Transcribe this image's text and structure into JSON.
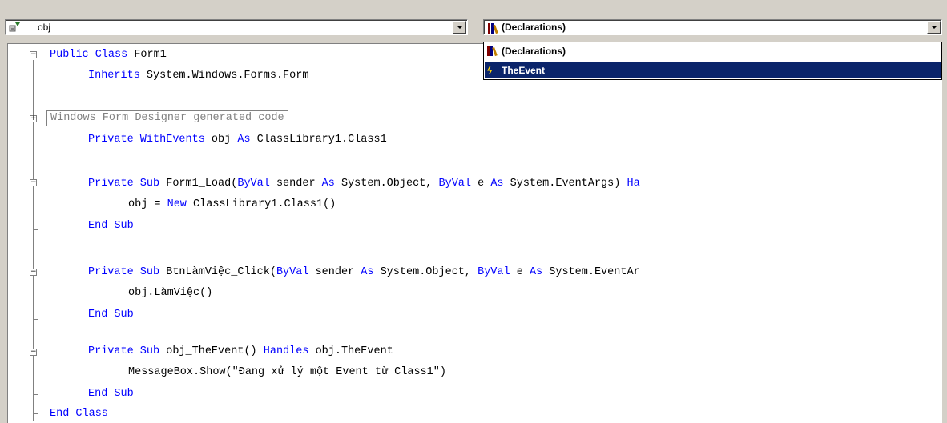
{
  "object_combo": {
    "value": "obj",
    "icon": "object-icon"
  },
  "member_combo": {
    "value": "(Declarations)",
    "icon": "declarations-icon"
  },
  "member_dropdown": {
    "items": [
      {
        "label": "(Declarations)",
        "icon": "declarations-icon",
        "selected": false
      },
      {
        "label": "TheEvent",
        "icon": "event-icon",
        "selected": true
      }
    ]
  },
  "code": {
    "lines": [
      [
        "Public Class",
        " Form1"
      ],
      [
        "Inherits",
        " System.Windows.Forms.Form"
      ],
      [
        "Windows Form Designer generated code"
      ],
      [
        "Private WithEvents",
        " obj ",
        "As",
        " ClassLibrary1.Class1"
      ],
      [
        "Private Sub",
        " Form1_Load(",
        "ByVal",
        " sender ",
        "As",
        " System.Object, ",
        "ByVal",
        " e ",
        "As",
        " System.EventArgs) ",
        "Ha"
      ],
      [
        "obj = ",
        "New",
        " ClassLibrary1.Class1()"
      ],
      [
        "End Sub"
      ],
      [
        "Private Sub",
        " BtnLàmViệc_Click(",
        "ByVal",
        " sender ",
        "As",
        " System.Object, ",
        "ByVal",
        " e ",
        "As",
        " System.EventAr"
      ],
      [
        "obj.LàmViệc()"
      ],
      [
        "End Sub"
      ],
      [
        "Private Sub",
        " obj_TheEvent() ",
        "Handles",
        " obj.TheEvent"
      ],
      [
        "MessageBox.Show(\"Đang xử lý một Event từ Class1\")"
      ],
      [
        "End Sub"
      ],
      [
        "End Class"
      ]
    ]
  },
  "colors": {
    "keyword": "#0000ff",
    "selection": "#0a246a",
    "region_text": "#808080"
  }
}
